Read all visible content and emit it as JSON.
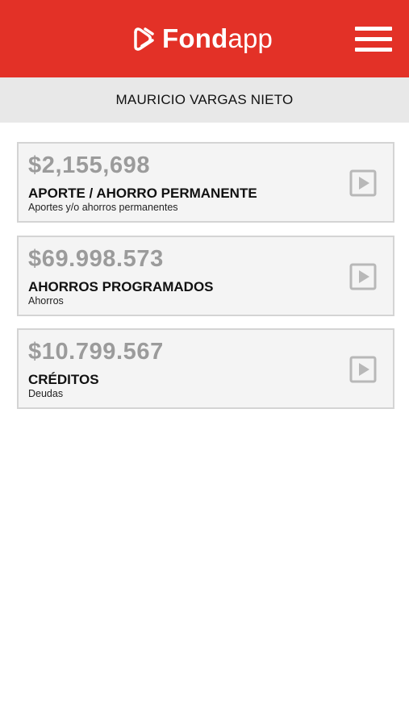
{
  "header": {
    "logo_bold": "Fond",
    "logo_light": "app",
    "brand_color": "#e33127",
    "menu_icon": "hamburger-menu-icon"
  },
  "user": {
    "name": "MAURICIO VARGAS NIETO"
  },
  "cards": [
    {
      "amount": "$2,155,698",
      "title": "APORTE / AHORRO PERMANENTE",
      "subtitle": "Aportes y/o ahorros permanentes",
      "icon": "play-icon"
    },
    {
      "amount": "$69.998.573",
      "title": "AHORROS PROGRAMADOS",
      "subtitle": "Ahorros",
      "icon": "play-icon"
    },
    {
      "amount": "$10.799.567",
      "title": "CRÉDITOS",
      "subtitle": "Deudas",
      "icon": "play-icon"
    }
  ]
}
